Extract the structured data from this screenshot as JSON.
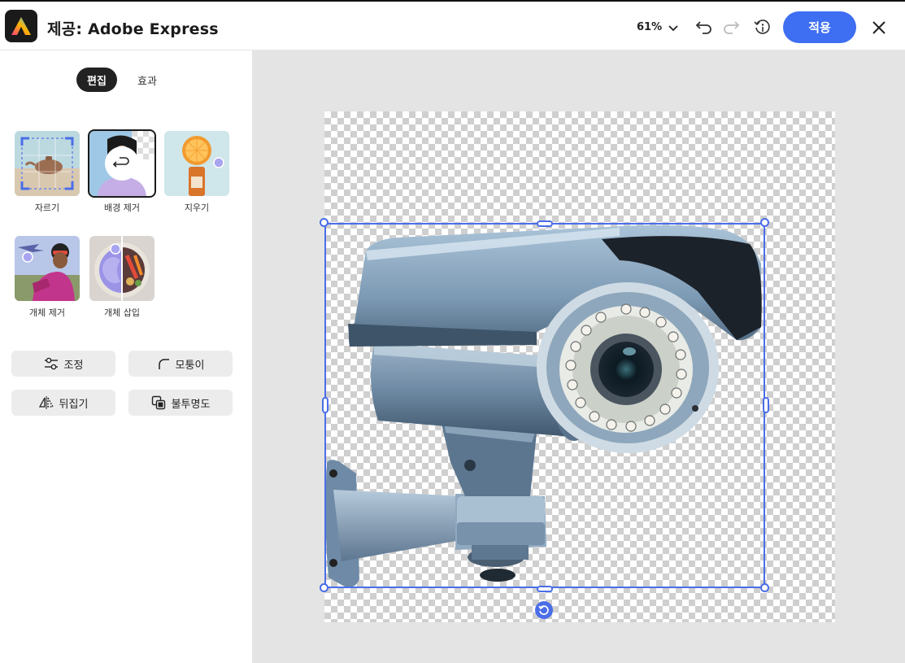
{
  "header": {
    "title": "제공: Adobe Express",
    "zoom": "61%",
    "apply_label": "적용"
  },
  "panel": {
    "tabs": [
      {
        "label": "편집",
        "active": true
      },
      {
        "label": "효과",
        "active": false
      }
    ],
    "tools": [
      {
        "label": "자르기"
      },
      {
        "label": "배경 제거",
        "selected": true
      },
      {
        "label": "지우기"
      },
      {
        "label": "개체 제거"
      },
      {
        "label": "개체 삽입"
      }
    ],
    "buttons": {
      "adjust": "조정",
      "corner": "모퉁이",
      "flip": "뒤집기",
      "opacity": "불투명도"
    }
  },
  "colors": {
    "accent": "#3e6ef2",
    "selection": "#4a6ee8",
    "workspace_bg": "#e4e4e4"
  }
}
